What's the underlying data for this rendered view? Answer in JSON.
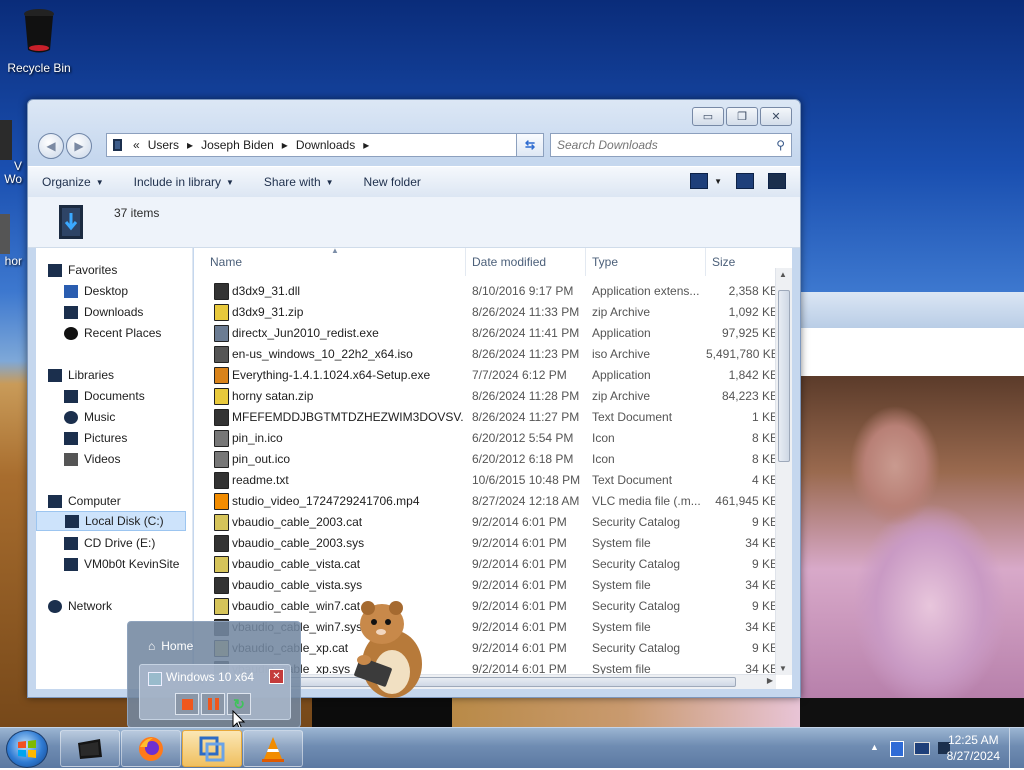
{
  "desktop": {
    "icons": [
      {
        "label": "Recycle Bin"
      },
      {
        "label": "V\nWo"
      },
      {
        "label": "hor"
      }
    ]
  },
  "explorer": {
    "caption": {
      "minimize": "▭",
      "maximize": "❐",
      "close": "✕"
    },
    "address": {
      "prefix": "«",
      "crumbs": [
        "Users",
        "Joseph Biden",
        "Downloads"
      ],
      "sep": "▸"
    },
    "search": {
      "placeholder": "Search Downloads"
    },
    "toolbar": {
      "organize": "Organize",
      "include": "Include in library",
      "share": "Share with",
      "new_folder": "New folder"
    },
    "info": {
      "count": "37 items"
    },
    "nav": {
      "favorites": "Favorites",
      "desktop": "Desktop",
      "downloads": "Downloads",
      "recent": "Recent Places",
      "libraries": "Libraries",
      "documents": "Documents",
      "music": "Music",
      "pictures": "Pictures",
      "videos": "Videos",
      "computer": "Computer",
      "local_disk": "Local Disk (C:)",
      "cd_drive": "CD Drive (E:)",
      "vm_site": "VM0b0t KevinSite",
      "network": "Network"
    },
    "columns": {
      "name": "Name",
      "date": "Date modified",
      "type": "Type",
      "size": "Size"
    },
    "files": [
      {
        "name": "d3dx9_31.dll",
        "date": "8/10/2016 9:17 PM",
        "type": "Application extens...",
        "size": "2,358 KE",
        "icon": "dll"
      },
      {
        "name": "d3dx9_31.zip",
        "date": "8/26/2024 11:33 PM",
        "type": "zip Archive",
        "size": "1,092 KE",
        "icon": "zip"
      },
      {
        "name": "directx_Jun2010_redist.exe",
        "date": "8/26/2024 11:41 PM",
        "type": "Application",
        "size": "97,925 KE",
        "icon": "exe"
      },
      {
        "name": "en-us_windows_10_22h2_x64.iso",
        "date": "8/26/2024 11:23 PM",
        "type": "iso Archive",
        "size": "5,491,780 KE",
        "icon": "iso"
      },
      {
        "name": "Everything-1.4.1.1024.x64-Setup.exe",
        "date": "7/7/2024 6:12 PM",
        "type": "Application",
        "size": "1,842 KE",
        "icon": "search"
      },
      {
        "name": "horny satan.zip",
        "date": "8/26/2024 11:28 PM",
        "type": "zip Archive",
        "size": "84,223 KE",
        "icon": "zip"
      },
      {
        "name": "MFEFEMDDJBGTMTDZHEZWIM3DOVSV...",
        "date": "8/26/2024 11:27 PM",
        "type": "Text Document",
        "size": "1 KE",
        "icon": "txt"
      },
      {
        "name": "pin_in.ico",
        "date": "6/20/2012 5:54 PM",
        "type": "Icon",
        "size": "8 KE",
        "icon": "ico"
      },
      {
        "name": "pin_out.ico",
        "date": "6/20/2012 6:18 PM",
        "type": "Icon",
        "size": "8 KE",
        "icon": "ico"
      },
      {
        "name": "readme.txt",
        "date": "10/6/2015 10:48 PM",
        "type": "Text Document",
        "size": "4 KE",
        "icon": "txt"
      },
      {
        "name": "studio_video_1724729241706.mp4",
        "date": "8/27/2024 12:18 AM",
        "type": "VLC media file (.m...",
        "size": "461,945 KE",
        "icon": "vlc"
      },
      {
        "name": "vbaudio_cable_2003.cat",
        "date": "9/2/2014 6:01 PM",
        "type": "Security Catalog",
        "size": "9 KE",
        "icon": "cat"
      },
      {
        "name": "vbaudio_cable_2003.sys",
        "date": "9/2/2014 6:01 PM",
        "type": "System file",
        "size": "34 KE",
        "icon": "sys"
      },
      {
        "name": "vbaudio_cable_vista.cat",
        "date": "9/2/2014 6:01 PM",
        "type": "Security Catalog",
        "size": "9 KE",
        "icon": "cat"
      },
      {
        "name": "vbaudio_cable_vista.sys",
        "date": "9/2/2014 6:01 PM",
        "type": "System file",
        "size": "34 KE",
        "icon": "sys"
      },
      {
        "name": "vbaudio_cable_win7.cat",
        "date": "9/2/2014 6:01 PM",
        "type": "Security Catalog",
        "size": "9 KE",
        "icon": "cat"
      },
      {
        "name": "vbaudio_cable_win7.sys",
        "date": "9/2/2014 6:01 PM",
        "type": "System file",
        "size": "34 KE",
        "icon": "sys"
      },
      {
        "name": "vbaudio_cable_xp.cat",
        "date": "9/2/2014 6:01 PM",
        "type": "Security Catalog",
        "size": "9 KE",
        "icon": "cat"
      },
      {
        "name": "vbaudio_cable_xp.sys",
        "date": "9/2/2014 6:01 PM",
        "type": "System file",
        "size": "34 KE",
        "icon": "sys"
      }
    ]
  },
  "popup": {
    "home": "Home",
    "vm_name": "Windows 10 x64",
    "close": "✕"
  },
  "taskbar": {
    "apps": [
      "explorer-window",
      "firefox",
      "vmware",
      "vlc"
    ],
    "time": "12:25 AM",
    "date": "8/27/2024"
  },
  "colors": {
    "selection": "#cde3fb",
    "accent": "#1f5fbf",
    "vlc": "#f28c00"
  }
}
